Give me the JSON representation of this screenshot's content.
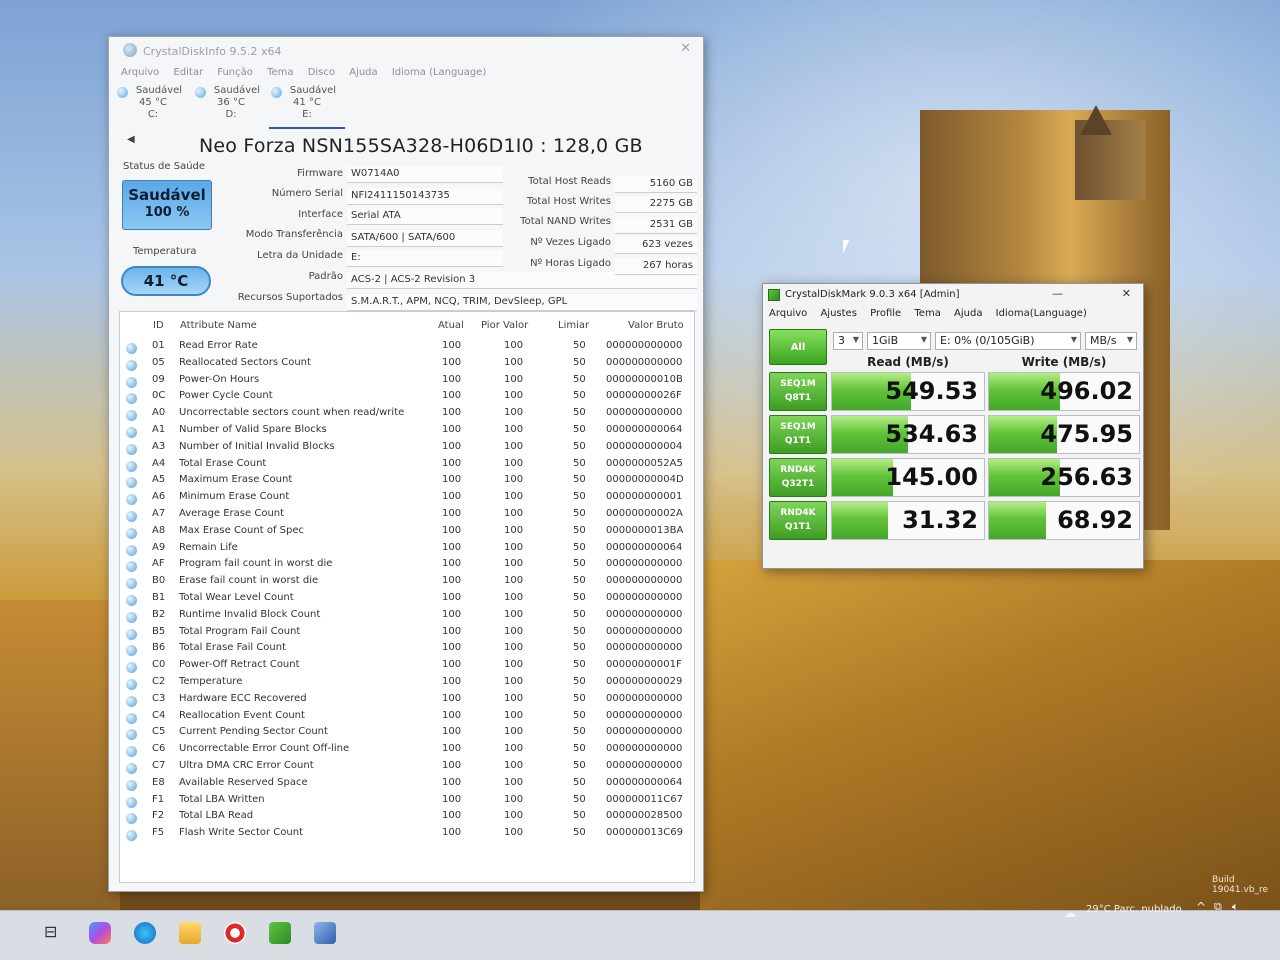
{
  "colors": {
    "health_blue": "#5aa8e6",
    "cdm_green": "#3aa41f",
    "taskbar": "#d9dde4"
  },
  "desktop": {
    "build_text": "Build 19041.vb_re"
  },
  "cdi": {
    "title": "CrystalDiskInfo 9.5.2 x64",
    "menu": [
      "Arquivo",
      "Editar",
      "Função",
      "Tema",
      "Disco",
      "Ajuda",
      "Idioma (Language)"
    ],
    "disks": [
      {
        "status": "Saudável",
        "temp": "45 °C",
        "letter": "C:"
      },
      {
        "status": "Saudável",
        "temp": "36 °C",
        "letter": "D:"
      },
      {
        "status": "Saudável",
        "temp": "41 °C",
        "letter": "E:"
      }
    ],
    "model": "Neo Forza NSN155SA328-H06D1I0 : 128,0 GB",
    "health_label": "Status de Saúde",
    "health_status": "Saudável",
    "health_percent": "100 %",
    "temp_label": "Temperatura",
    "temperature": "41 °C",
    "fields": {
      "firmware_label": "Firmware",
      "firmware": "W0714A0",
      "serial_label": "Número Serial",
      "serial": "NFI2411150143735",
      "interface_label": "Interface",
      "interface": "Serial ATA",
      "transfer_label": "Modo Transferência",
      "transfer": "SATA/600 | SATA/600",
      "drive_label": "Letra da Unidade",
      "drive": "E:",
      "standard_label": "Padrão",
      "standard": "ACS-2 | ACS-2 Revision 3",
      "features_label": "Recursos Suportados",
      "features": "S.M.A.R.T., APM, NCQ, TRIM, DevSleep, GPL"
    },
    "stats": {
      "host_reads_label": "Total Host Reads",
      "host_reads": "5160 GB",
      "host_writes_label": "Total Host Writes",
      "host_writes": "2275 GB",
      "nand_writes_label": "Total NAND Writes",
      "nand_writes": "2531 GB",
      "power_count_label": "Nº Vezes Ligado",
      "power_count": "623 vezes",
      "power_hours_label": "Nº Horas Ligado",
      "power_hours": "267 horas"
    },
    "table_headers": {
      "id": "ID",
      "name": "Attribute Name",
      "current": "Atual",
      "worst": "Pior Valor",
      "threshold": "Limiar",
      "raw": "Valor Bruto"
    },
    "attributes": [
      {
        "id": "01",
        "name": "Read Error Rate",
        "current": "100",
        "worst": "100",
        "threshold": "50",
        "raw": "000000000000"
      },
      {
        "id": "05",
        "name": "Reallocated Sectors Count",
        "current": "100",
        "worst": "100",
        "threshold": "50",
        "raw": "000000000000"
      },
      {
        "id": "09",
        "name": "Power-On Hours",
        "current": "100",
        "worst": "100",
        "threshold": "50",
        "raw": "00000000010B"
      },
      {
        "id": "0C",
        "name": "Power Cycle Count",
        "current": "100",
        "worst": "100",
        "threshold": "50",
        "raw": "00000000026F"
      },
      {
        "id": "A0",
        "name": "Uncorrectable sectors count when read/write",
        "current": "100",
        "worst": "100",
        "threshold": "50",
        "raw": "000000000000"
      },
      {
        "id": "A1",
        "name": "Number of Valid Spare Blocks",
        "current": "100",
        "worst": "100",
        "threshold": "50",
        "raw": "000000000064"
      },
      {
        "id": "A3",
        "name": "Number of Initial Invalid Blocks",
        "current": "100",
        "worst": "100",
        "threshold": "50",
        "raw": "000000000004"
      },
      {
        "id": "A4",
        "name": "Total Erase Count",
        "current": "100",
        "worst": "100",
        "threshold": "50",
        "raw": "0000000052A5"
      },
      {
        "id": "A5",
        "name": "Maximum Erase Count",
        "current": "100",
        "worst": "100",
        "threshold": "50",
        "raw": "00000000004D"
      },
      {
        "id": "A6",
        "name": "Minimum Erase Count",
        "current": "100",
        "worst": "100",
        "threshold": "50",
        "raw": "000000000001"
      },
      {
        "id": "A7",
        "name": "Average Erase Count",
        "current": "100",
        "worst": "100",
        "threshold": "50",
        "raw": "00000000002A"
      },
      {
        "id": "A8",
        "name": "Max Erase Count of Spec",
        "current": "100",
        "worst": "100",
        "threshold": "50",
        "raw": "0000000013BA"
      },
      {
        "id": "A9",
        "name": "Remain Life",
        "current": "100",
        "worst": "100",
        "threshold": "50",
        "raw": "000000000064"
      },
      {
        "id": "AF",
        "name": "Program fail count in worst die",
        "current": "100",
        "worst": "100",
        "threshold": "50",
        "raw": "000000000000"
      },
      {
        "id": "B0",
        "name": "Erase fail count in worst die",
        "current": "100",
        "worst": "100",
        "threshold": "50",
        "raw": "000000000000"
      },
      {
        "id": "B1",
        "name": "Total Wear Level Count",
        "current": "100",
        "worst": "100",
        "threshold": "50",
        "raw": "000000000000"
      },
      {
        "id": "B2",
        "name": "Runtime Invalid Block Count",
        "current": "100",
        "worst": "100",
        "threshold": "50",
        "raw": "000000000000"
      },
      {
        "id": "B5",
        "name": "Total Program Fail Count",
        "current": "100",
        "worst": "100",
        "threshold": "50",
        "raw": "000000000000"
      },
      {
        "id": "B6",
        "name": "Total Erase Fail Count",
        "current": "100",
        "worst": "100",
        "threshold": "50",
        "raw": "000000000000"
      },
      {
        "id": "C0",
        "name": "Power-Off Retract Count",
        "current": "100",
        "worst": "100",
        "threshold": "50",
        "raw": "00000000001F"
      },
      {
        "id": "C2",
        "name": "Temperature",
        "current": "100",
        "worst": "100",
        "threshold": "50",
        "raw": "000000000029"
      },
      {
        "id": "C3",
        "name": "Hardware ECC Recovered",
        "current": "100",
        "worst": "100",
        "threshold": "50",
        "raw": "000000000000"
      },
      {
        "id": "C4",
        "name": "Reallocation Event Count",
        "current": "100",
        "worst": "100",
        "threshold": "50",
        "raw": "000000000000"
      },
      {
        "id": "C5",
        "name": "Current Pending Sector Count",
        "current": "100",
        "worst": "100",
        "threshold": "50",
        "raw": "000000000000"
      },
      {
        "id": "C6",
        "name": "Uncorrectable Error Count Off-line",
        "current": "100",
        "worst": "100",
        "threshold": "50",
        "raw": "000000000000"
      },
      {
        "id": "C7",
        "name": "Ultra DMA CRC Error Count",
        "current": "100",
        "worst": "100",
        "threshold": "50",
        "raw": "000000000000"
      },
      {
        "id": "E8",
        "name": "Available Reserved Space",
        "current": "100",
        "worst": "100",
        "threshold": "50",
        "raw": "000000000064"
      },
      {
        "id": "F1",
        "name": "Total LBA Written",
        "current": "100",
        "worst": "100",
        "threshold": "50",
        "raw": "000000011C67"
      },
      {
        "id": "F2",
        "name": "Total LBA Read",
        "current": "100",
        "worst": "100",
        "threshold": "50",
        "raw": "000000028500"
      },
      {
        "id": "F5",
        "name": "Flash Write Sector Count",
        "current": "100",
        "worst": "100",
        "threshold": "50",
        "raw": "000000013C69"
      }
    ]
  },
  "cdm": {
    "title": "CrystalDiskMark 9.0.3 x64 [Admin]",
    "menu": [
      "Arquivo",
      "Ajustes",
      "Profile",
      "Tema",
      "Ajuda",
      "Idioma(Language)"
    ],
    "all_label": "All",
    "count": "3",
    "size": "1GiB",
    "drive": "E: 0% (0/105GiB)",
    "unit": "MB/s",
    "read_header": "Read (MB/s)",
    "write_header": "Write (MB/s)",
    "tests": [
      {
        "l1": "SEQ1M",
        "l2": "Q8T1",
        "read": "549.53",
        "write": "496.02",
        "read_fill": 0.52,
        "write_fill": 0.47
      },
      {
        "l1": "SEQ1M",
        "l2": "Q1T1",
        "read": "534.63",
        "write": "475.95",
        "read_fill": 0.5,
        "write_fill": 0.45
      },
      {
        "l1": "RND4K",
        "l2": "Q32T1",
        "read": "145.00",
        "write": "256.63",
        "read_fill": 0.4,
        "write_fill": 0.47
      },
      {
        "l1": "RND4K",
        "l2": "Q1T1",
        "read": "31.32",
        "write": "68.92",
        "read_fill": 0.37,
        "write_fill": 0.38
      }
    ]
  },
  "taskbar": {
    "weather": "29°C  Parc. nublado",
    "chevron": "^"
  }
}
